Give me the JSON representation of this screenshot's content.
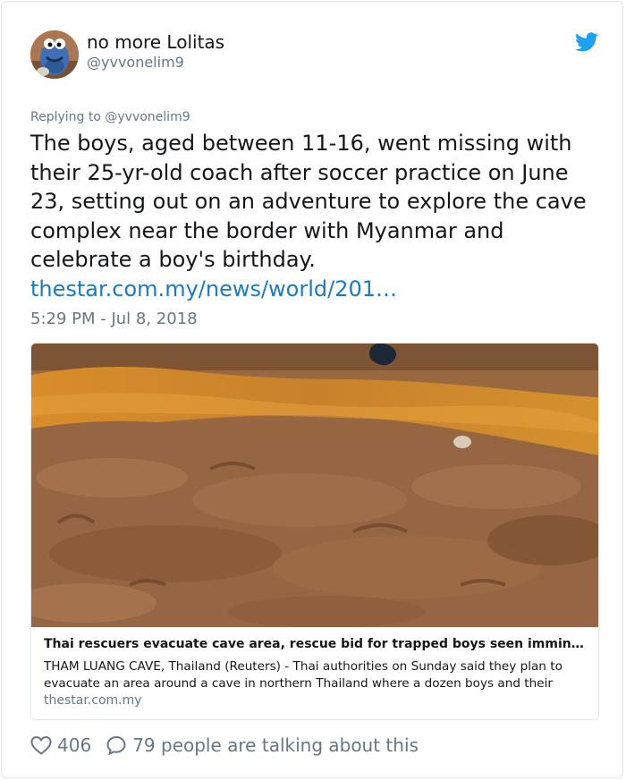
{
  "user": {
    "name": "no more Lolitas",
    "handle": "@yvvonelim9",
    "avatar_icon": "cookie-monster-avatar-icon"
  },
  "brand": {
    "icon": "twitter-bird-icon",
    "color": "#1da1f2"
  },
  "tweet": {
    "replying_to": "Replying to @yvvonelim9",
    "text": "The boys, aged between 11-16, went missing with their 25-yr-old coach after soccer practice on June 23, setting out on an adventure to explore the cave complex near the border with Myanmar and celebrate a boy's birthday.",
    "link": "thestar.com.my/news/world/201…",
    "timestamp": "5:29 PM - Jul 8, 2018"
  },
  "card": {
    "image_icon": "muddy-ground-photo",
    "title": "Thai rescuers evacuate cave area, rescue bid for trapped boys seen immin…",
    "description": "THAM LUANG CAVE, Thailand (Reuters) - Thai authorities on Sunday said they plan to evacuate an area around a cave in northern Thailand where a dozen boys and their",
    "domain": "thestar.com.my"
  },
  "actions": {
    "likes": "406",
    "replies_text": "79 people are talking about this",
    "like_icon": "heart-icon",
    "reply_icon": "speech-bubble-icon"
  },
  "colors": {
    "text": "#14171a",
    "muted": "#657786",
    "link": "#1b7ac0",
    "border": "#e1e8ed"
  }
}
